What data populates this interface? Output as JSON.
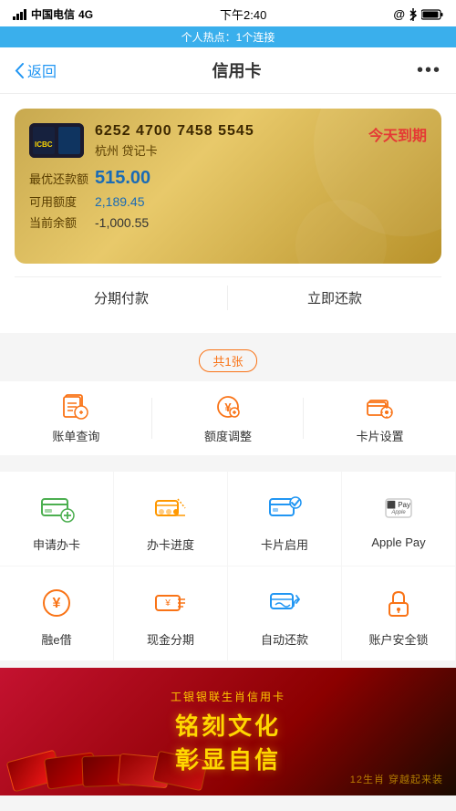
{
  "statusBar": {
    "carrier": "中国电信",
    "network": "4G",
    "time": "下午2:40",
    "bluetooth": "⬡",
    "battery": "▮▮▮"
  },
  "hotspotBar": {
    "text": "个人热点：1个连接"
  },
  "navBar": {
    "backLabel": "返回",
    "title": "信用卡",
    "moreIcon": "···"
  },
  "card": {
    "number": "6252 4700 7458 5545",
    "name": "杭州 贷记卡",
    "expireStatus": "今天到期",
    "minPaymentLabel": "最优还款额",
    "minPaymentValue": "515.00",
    "availableLabel": "可用额度",
    "availableValue": "2,189.45",
    "balanceLabel": "当前余额",
    "balanceValue": "-1,000.55",
    "action1": "分期付款",
    "action2": "立即还款"
  },
  "cardCount": {
    "text": "共1张"
  },
  "quickActions": [
    {
      "label": "账单查询",
      "icon": "bill-icon"
    },
    {
      "label": "额度调整",
      "icon": "limit-icon"
    },
    {
      "label": "卡片设置",
      "icon": "settings-icon"
    }
  ],
  "gridMenu": {
    "row1": [
      {
        "label": "申请办卡",
        "icon": "apply-card-icon"
      },
      {
        "label": "办卡进度",
        "icon": "progress-icon"
      },
      {
        "label": "卡片启用",
        "icon": "activate-icon"
      },
      {
        "label": "Apple Pay",
        "icon": "apple-pay-icon"
      }
    ],
    "row2": [
      {
        "label": "融e借",
        "icon": "loan-icon"
      },
      {
        "label": "现金分期",
        "icon": "cash-icon"
      },
      {
        "label": "自动还款",
        "icon": "auto-pay-icon"
      },
      {
        "label": "账户安全锁",
        "icon": "lock-icon"
      }
    ]
  },
  "banner": {
    "subtitle": "工银银联生肖信用卡",
    "title1": "铭刻文化",
    "title2": "彰显自信",
    "footnote": "12生肖 穿越起来装"
  }
}
